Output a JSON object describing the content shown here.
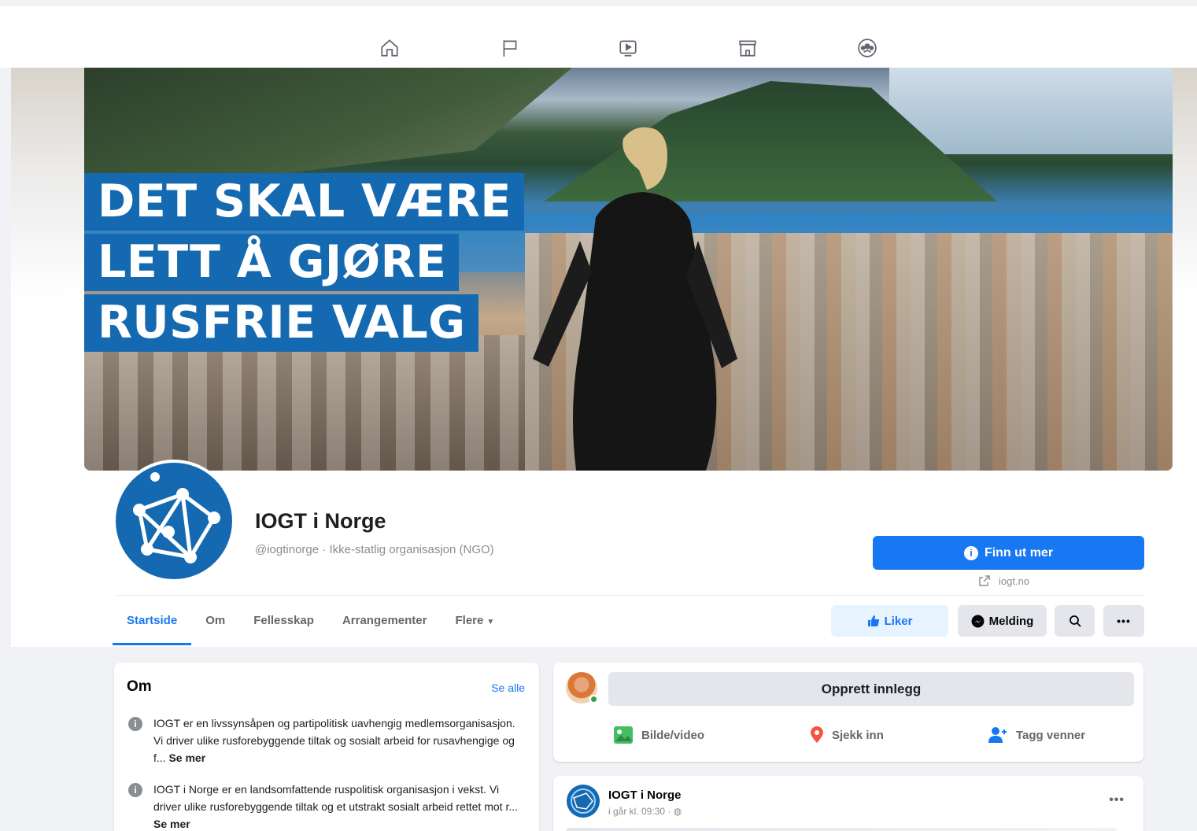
{
  "nav": {
    "icons": [
      "home-icon",
      "flag-icon",
      "video-icon",
      "marketplace-icon",
      "groups-icon"
    ]
  },
  "cover": {
    "headline": [
      "DET SKAL VÆRE",
      "LETT Å GJØRE",
      "RUSFRIE VALG"
    ],
    "headline_bg": "#1569b0"
  },
  "page": {
    "name": "IOGT i Norge",
    "subtitle": "@iogtinorge · Ikke-statlig organisasjon (NGO)",
    "primary_button": "Finn ut mer",
    "website": "iogt.no"
  },
  "tabs": [
    {
      "label": "Startside",
      "active": true
    },
    {
      "label": "Om"
    },
    {
      "label": "Fellesskap"
    },
    {
      "label": "Arrangementer"
    },
    {
      "label": "Flere"
    }
  ],
  "actions": {
    "like": "Liker",
    "message": "Melding"
  },
  "about": {
    "title": "Om",
    "see_all": "Se alle",
    "items": [
      {
        "text": "IOGT er en livssynsåpen og partipolitisk uavhengig medlemsorganisasjon. Vi driver ulike rusforebyggende tiltak og sosialt arbeid for rusavhengige og f...",
        "more": "Se mer"
      },
      {
        "text": "IOGT i Norge er en landsomfattende ruspolitisk organisasjon i vekst. Vi driver ulike rusforebyggende tiltak og et utstrakt sosialt arbeid rettet mot r...",
        "more": "Se mer"
      }
    ]
  },
  "composer": {
    "prompt": "Opprett innlegg",
    "photo": "Bilde/video",
    "checkin": "Sjekk inn",
    "tag": "Tagg venner"
  },
  "post": {
    "author": "IOGT i Norge",
    "time": "i går kl. 09:30 · "
  },
  "colors": {
    "accent": "#1877f2",
    "brand": "#1569b0"
  }
}
